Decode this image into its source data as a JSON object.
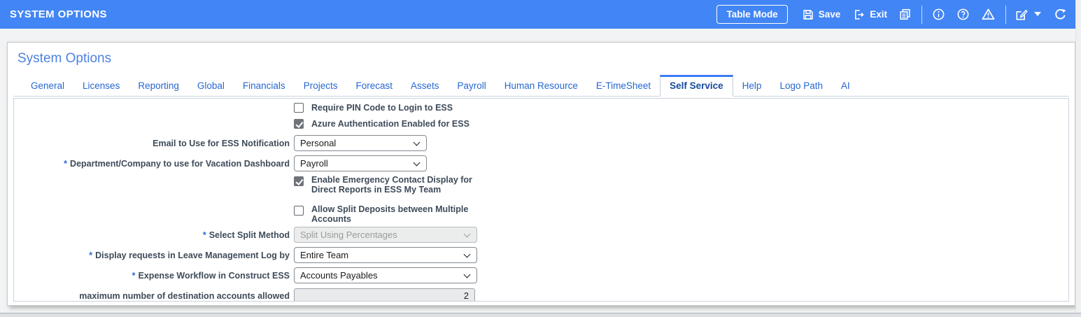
{
  "header": {
    "title": "SYSTEM OPTIONS",
    "table_mode_label": "Table Mode",
    "save_label": "Save",
    "exit_label": "Exit",
    "icons": [
      "save-icon",
      "exit-icon",
      "documents-icon",
      "info-icon",
      "help-icon",
      "warning-icon",
      "edit-icon",
      "chevron-down-icon",
      "refresh-icon"
    ]
  },
  "page": {
    "title": "System Options",
    "tabs": [
      {
        "label": "General"
      },
      {
        "label": "Licenses"
      },
      {
        "label": "Reporting"
      },
      {
        "label": "Global"
      },
      {
        "label": "Financials"
      },
      {
        "label": "Projects"
      },
      {
        "label": "Forecast"
      },
      {
        "label": "Assets"
      },
      {
        "label": "Payroll"
      },
      {
        "label": "Human Resource"
      },
      {
        "label": "E-TimeSheet"
      },
      {
        "label": "Self Service",
        "selected": true
      },
      {
        "label": "Help"
      },
      {
        "label": "Logo Path"
      },
      {
        "label": "AI"
      }
    ]
  },
  "form": {
    "required_marker": "*",
    "fields": [
      {
        "type": "checkbox",
        "label": "Require PIN Code to Login to ESS",
        "checked": false
      },
      {
        "type": "checkbox",
        "label": "Azure Authentication Enabled for ESS",
        "checked": true
      },
      {
        "type": "select",
        "label": "Email to Use for ESS Notification",
        "required": false,
        "value": "Personal",
        "disabled": false
      },
      {
        "type": "select",
        "label": "Department/Company to use for Vacation Dashboard",
        "required": true,
        "value": "Payroll",
        "disabled": false
      },
      {
        "type": "checkbox",
        "label": "Enable Emergency Contact Display for Direct Reports in ESS My Team",
        "checked": true
      },
      {
        "type": "checkbox",
        "label": "Allow Split Deposits between Multiple Accounts",
        "checked": false
      },
      {
        "type": "select",
        "label": "Select Split Method",
        "required": true,
        "value": "Split Using Percentages",
        "disabled": true
      },
      {
        "type": "select",
        "label": "Display requests in Leave Management Log by",
        "required": true,
        "value": "Entire Team",
        "disabled": false
      },
      {
        "type": "select",
        "label": "Expense Workflow in Construct ESS",
        "required": true,
        "value": "Accounts Payables",
        "disabled": false
      },
      {
        "type": "input",
        "label": "maximum number of destination accounts allowed",
        "required": false,
        "value": "2",
        "disabled": true
      }
    ]
  },
  "colors": {
    "header_blue": "#4285f4",
    "tab_blue": "#2767d2",
    "selected_tab_text": "#16499e",
    "selected_tab_accent": "#3c7cf2",
    "label_color": "#3e4b59",
    "required_asterisk": "#2b6bd8",
    "checkbox_checked_fill": "#70747a",
    "disabled_field_bg": "#ebecec"
  }
}
